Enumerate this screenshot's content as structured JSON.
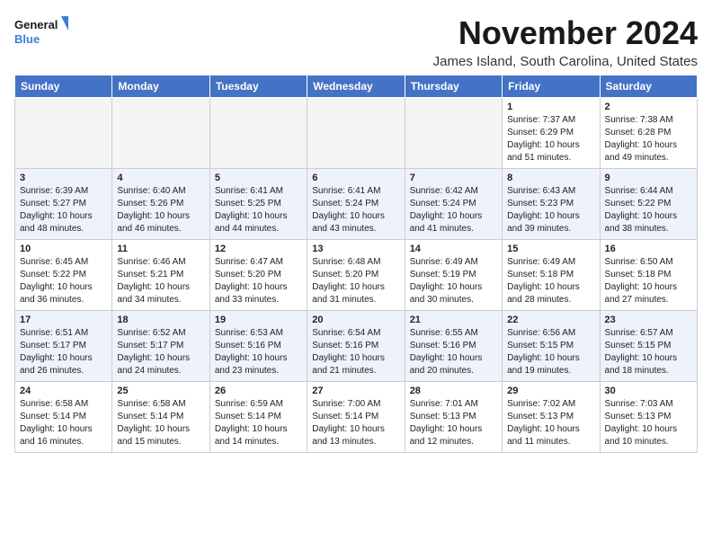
{
  "logo": {
    "line1": "General",
    "line2": "Blue"
  },
  "title": "November 2024",
  "subtitle": "James Island, South Carolina, United States",
  "weekdays": [
    "Sunday",
    "Monday",
    "Tuesday",
    "Wednesday",
    "Thursday",
    "Friday",
    "Saturday"
  ],
  "weeks": [
    [
      {
        "day": "",
        "info": ""
      },
      {
        "day": "",
        "info": ""
      },
      {
        "day": "",
        "info": ""
      },
      {
        "day": "",
        "info": ""
      },
      {
        "day": "",
        "info": ""
      },
      {
        "day": "1",
        "info": "Sunrise: 7:37 AM\nSunset: 6:29 PM\nDaylight: 10 hours and 51 minutes."
      },
      {
        "day": "2",
        "info": "Sunrise: 7:38 AM\nSunset: 6:28 PM\nDaylight: 10 hours and 49 minutes."
      }
    ],
    [
      {
        "day": "3",
        "info": "Sunrise: 6:39 AM\nSunset: 5:27 PM\nDaylight: 10 hours and 48 minutes."
      },
      {
        "day": "4",
        "info": "Sunrise: 6:40 AM\nSunset: 5:26 PM\nDaylight: 10 hours and 46 minutes."
      },
      {
        "day": "5",
        "info": "Sunrise: 6:41 AM\nSunset: 5:25 PM\nDaylight: 10 hours and 44 minutes."
      },
      {
        "day": "6",
        "info": "Sunrise: 6:41 AM\nSunset: 5:24 PM\nDaylight: 10 hours and 43 minutes."
      },
      {
        "day": "7",
        "info": "Sunrise: 6:42 AM\nSunset: 5:24 PM\nDaylight: 10 hours and 41 minutes."
      },
      {
        "day": "8",
        "info": "Sunrise: 6:43 AM\nSunset: 5:23 PM\nDaylight: 10 hours and 39 minutes."
      },
      {
        "day": "9",
        "info": "Sunrise: 6:44 AM\nSunset: 5:22 PM\nDaylight: 10 hours and 38 minutes."
      }
    ],
    [
      {
        "day": "10",
        "info": "Sunrise: 6:45 AM\nSunset: 5:22 PM\nDaylight: 10 hours and 36 minutes."
      },
      {
        "day": "11",
        "info": "Sunrise: 6:46 AM\nSunset: 5:21 PM\nDaylight: 10 hours and 34 minutes."
      },
      {
        "day": "12",
        "info": "Sunrise: 6:47 AM\nSunset: 5:20 PM\nDaylight: 10 hours and 33 minutes."
      },
      {
        "day": "13",
        "info": "Sunrise: 6:48 AM\nSunset: 5:20 PM\nDaylight: 10 hours and 31 minutes."
      },
      {
        "day": "14",
        "info": "Sunrise: 6:49 AM\nSunset: 5:19 PM\nDaylight: 10 hours and 30 minutes."
      },
      {
        "day": "15",
        "info": "Sunrise: 6:49 AM\nSunset: 5:18 PM\nDaylight: 10 hours and 28 minutes."
      },
      {
        "day": "16",
        "info": "Sunrise: 6:50 AM\nSunset: 5:18 PM\nDaylight: 10 hours and 27 minutes."
      }
    ],
    [
      {
        "day": "17",
        "info": "Sunrise: 6:51 AM\nSunset: 5:17 PM\nDaylight: 10 hours and 26 minutes."
      },
      {
        "day": "18",
        "info": "Sunrise: 6:52 AM\nSunset: 5:17 PM\nDaylight: 10 hours and 24 minutes."
      },
      {
        "day": "19",
        "info": "Sunrise: 6:53 AM\nSunset: 5:16 PM\nDaylight: 10 hours and 23 minutes."
      },
      {
        "day": "20",
        "info": "Sunrise: 6:54 AM\nSunset: 5:16 PM\nDaylight: 10 hours and 21 minutes."
      },
      {
        "day": "21",
        "info": "Sunrise: 6:55 AM\nSunset: 5:16 PM\nDaylight: 10 hours and 20 minutes."
      },
      {
        "day": "22",
        "info": "Sunrise: 6:56 AM\nSunset: 5:15 PM\nDaylight: 10 hours and 19 minutes."
      },
      {
        "day": "23",
        "info": "Sunrise: 6:57 AM\nSunset: 5:15 PM\nDaylight: 10 hours and 18 minutes."
      }
    ],
    [
      {
        "day": "24",
        "info": "Sunrise: 6:58 AM\nSunset: 5:14 PM\nDaylight: 10 hours and 16 minutes."
      },
      {
        "day": "25",
        "info": "Sunrise: 6:58 AM\nSunset: 5:14 PM\nDaylight: 10 hours and 15 minutes."
      },
      {
        "day": "26",
        "info": "Sunrise: 6:59 AM\nSunset: 5:14 PM\nDaylight: 10 hours and 14 minutes."
      },
      {
        "day": "27",
        "info": "Sunrise: 7:00 AM\nSunset: 5:14 PM\nDaylight: 10 hours and 13 minutes."
      },
      {
        "day": "28",
        "info": "Sunrise: 7:01 AM\nSunset: 5:13 PM\nDaylight: 10 hours and 12 minutes."
      },
      {
        "day": "29",
        "info": "Sunrise: 7:02 AM\nSunset: 5:13 PM\nDaylight: 10 hours and 11 minutes."
      },
      {
        "day": "30",
        "info": "Sunrise: 7:03 AM\nSunset: 5:13 PM\nDaylight: 10 hours and 10 minutes."
      }
    ]
  ]
}
